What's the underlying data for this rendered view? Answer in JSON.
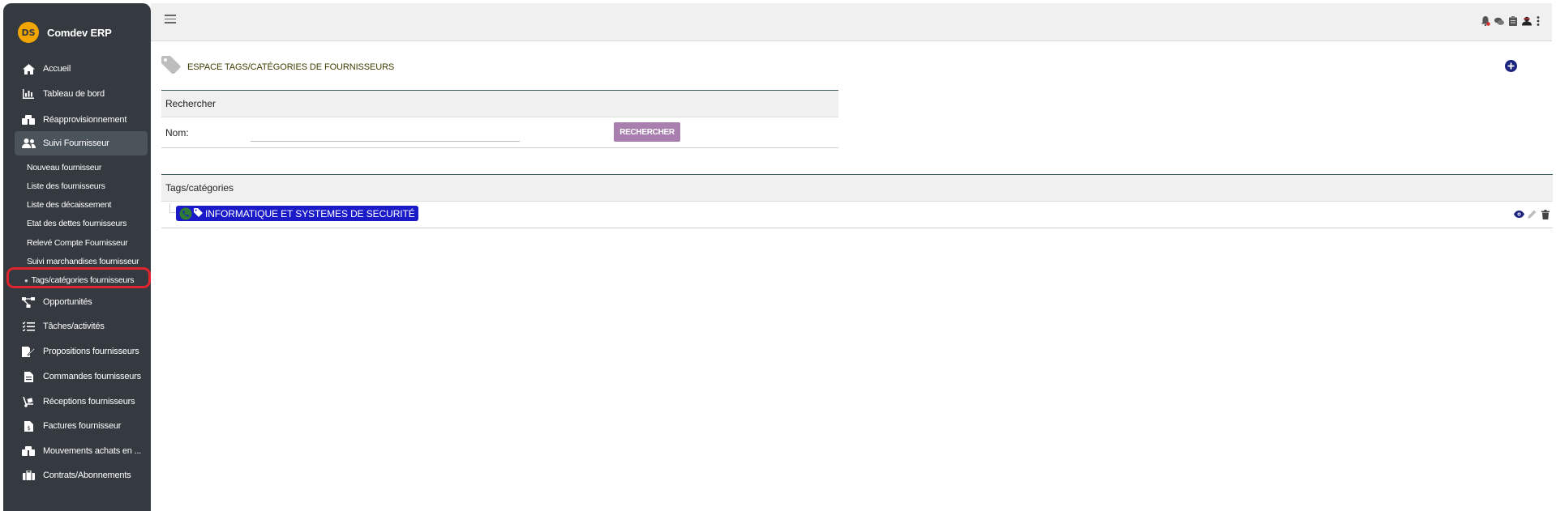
{
  "app": {
    "name": "Comdev ERP",
    "logo_text": "DS"
  },
  "sidebar": {
    "items": [
      {
        "label": "Accueil",
        "icon": "home-icon"
      },
      {
        "label": "Tableau de bord",
        "icon": "chart-icon"
      },
      {
        "label": "Réapprovisionnement",
        "icon": "boxes-icon"
      },
      {
        "label": "Suivi Fournisseur",
        "icon": "users-icon"
      },
      {
        "label": "Opportunités",
        "icon": "flow-icon"
      },
      {
        "label": "Tâches/activités",
        "icon": "tasks-icon"
      },
      {
        "label": "Propositions fournisseurs",
        "icon": "signature-icon"
      },
      {
        "label": "Commandes fournisseurs",
        "icon": "file-icon"
      },
      {
        "label": "Réceptions fournisseurs",
        "icon": "dolly-icon"
      },
      {
        "label": "Factures fournisseur",
        "icon": "invoice-icon"
      },
      {
        "label": "Mouvements achats en ...",
        "icon": "boxes-icon"
      },
      {
        "label": "Contrats/Abonnements",
        "icon": "briefcase-icon"
      }
    ],
    "submenu": [
      "Nouveau fournisseur",
      "Liste des fournisseurs",
      "Liste des décaissement",
      "Etat des dettes fournisseurs",
      "Relevé Compte Fournisseur",
      "Suivi marchandises fournisseur",
      "Tags/catégories fournisseurs"
    ]
  },
  "topbar": {
    "icons": [
      "bell-icon",
      "chat-icon",
      "clipboard-icon",
      "user-avatar-icon",
      "more-vertical-icon"
    ]
  },
  "page": {
    "title": "ESPACE TAGS/CATÉGORIES DE FOURNISSEURS"
  },
  "search": {
    "heading": "Rechercher",
    "name_label": "Nom:",
    "name_value": "",
    "button_label": "RECHERCHER"
  },
  "tags": {
    "heading": "Tags/catégories",
    "rows": [
      {
        "label": "INFORMATIQUE ET SYSTEMES DE SECURITÉ",
        "color": "#1a1ac8"
      }
    ]
  },
  "colors": {
    "sidebar_bg": "#343a40",
    "highlight": "#e0242d",
    "search_button": "#a97fb0",
    "tag_badge": "#1a1ac8",
    "action_blue": "#1a237e"
  }
}
